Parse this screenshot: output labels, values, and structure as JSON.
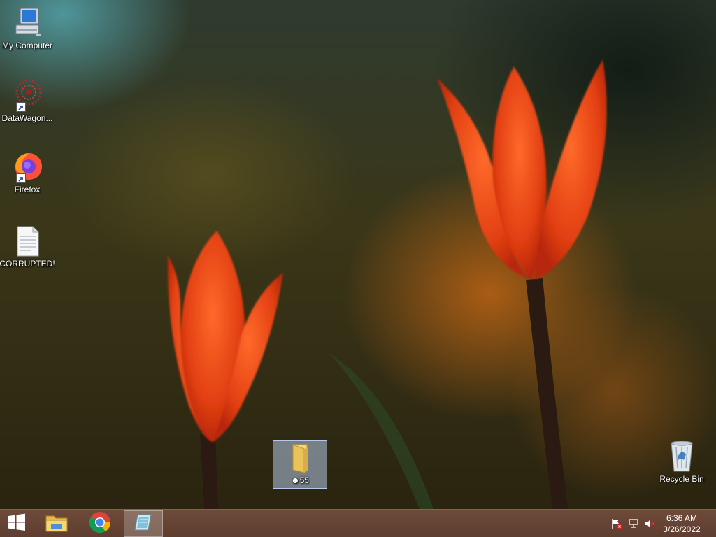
{
  "desktop": {
    "icons": [
      {
        "label": "My Computer",
        "icon": "computer-icon"
      },
      {
        "label": "DataWagon...",
        "icon": "datawagon-icon"
      },
      {
        "label": "Firefox",
        "icon": "firefox-icon"
      },
      {
        "label": "CORRUPTED!",
        "icon": "text-file-icon"
      },
      {
        "label": "Recycle Bin",
        "icon": "recycle-bin-icon"
      }
    ],
    "selected_folder": {
      "label": "☻55",
      "icon": "folder-icon"
    }
  },
  "taskbar": {
    "start_icon": "windows-logo-icon",
    "pinned": [
      {
        "icon": "file-explorer-icon",
        "active": false
      },
      {
        "icon": "chrome-icon",
        "active": false
      },
      {
        "icon": "notepad-app-icon",
        "active": true
      }
    ],
    "tray": [
      "action-center-flag-icon",
      "network-icon",
      "volume-muted-icon"
    ],
    "clock": {
      "time": "6:36 AM",
      "date": "3/26/2022"
    }
  },
  "colors": {
    "taskbar": "#6e4a39",
    "tulip": "#e8451a",
    "selection": "#b7c9e6"
  }
}
